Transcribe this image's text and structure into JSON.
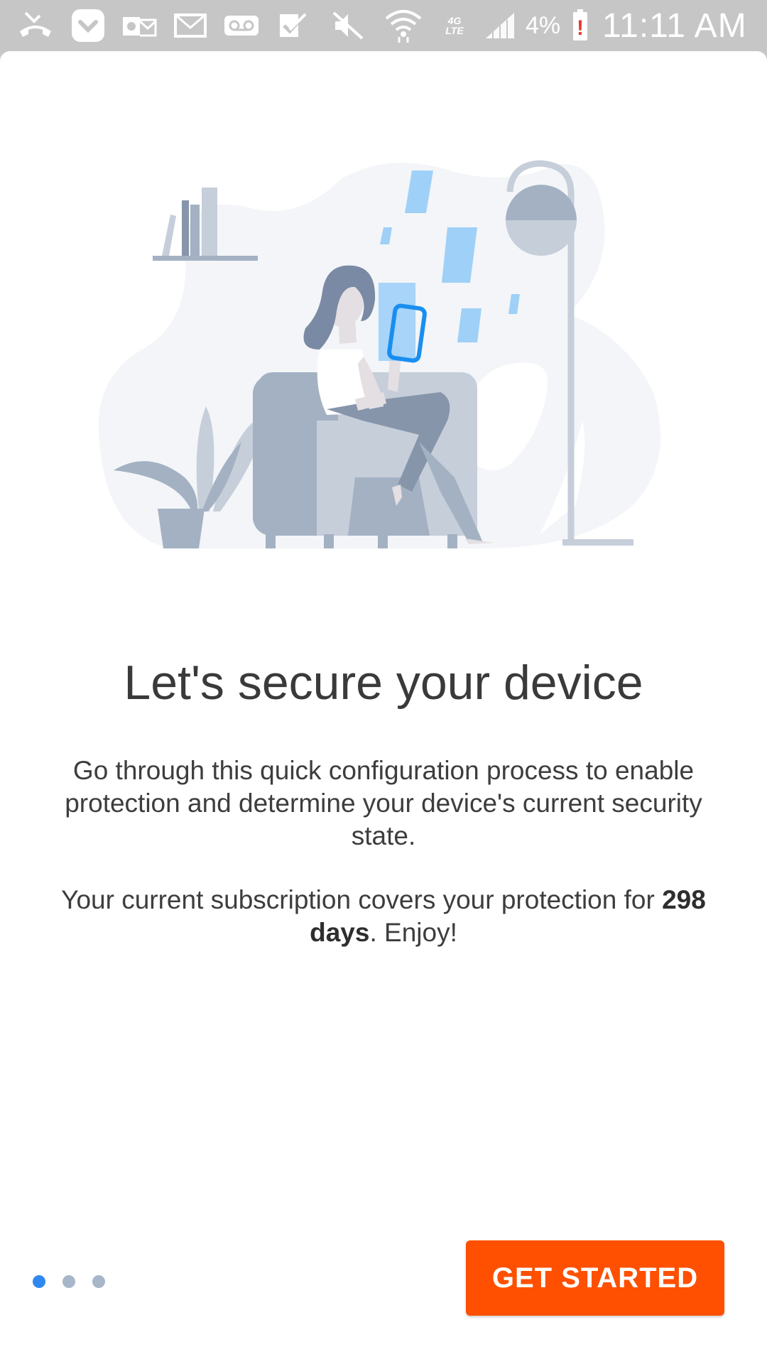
{
  "status_bar": {
    "icons": [
      "missed-call-icon",
      "pocket-icon",
      "outlook-icon",
      "email-icon",
      "voicemail-icon",
      "task-check-icon",
      "mute-icon",
      "wifi-icon",
      "4g-lte-icon",
      "signal-icon"
    ],
    "network_label": "4G LTE",
    "battery_percent": "4%",
    "battery_alert": "!",
    "time": "11:11 AM"
  },
  "onboarding": {
    "illustration": "woman-on-armchair-with-phone-illustration",
    "title": "Let's secure your device",
    "description": "Go through this quick configuration process to enable protection and determine your device's current security state.",
    "subscription_prefix": "Your current subscription covers your protection for ",
    "subscription_days": "298 days",
    "subscription_suffix": ". Enjoy!"
  },
  "pager": {
    "total": 3,
    "current": 1
  },
  "actions": {
    "get_started_label": "GET STARTED"
  },
  "colors": {
    "accent": "#fe5000",
    "pager_active": "#2f88ee",
    "pager_inactive": "#a7b6c9",
    "status_bar": "#c6c6c6"
  }
}
